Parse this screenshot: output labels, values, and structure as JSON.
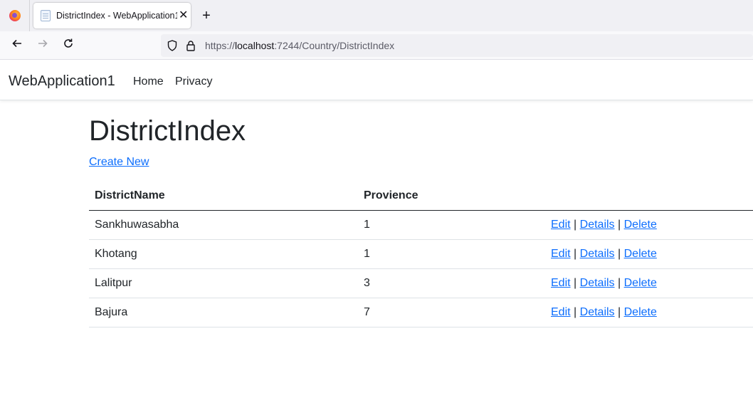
{
  "browser": {
    "tab_title": "DistrictIndex - WebApplication1",
    "tab_close": "✕",
    "new_tab": "+",
    "url_prefix": "https://",
    "url_host": "localhost",
    "url_path": ":7244/Country/DistrictIndex"
  },
  "app": {
    "brand": "WebApplication1",
    "nav": {
      "home": "Home",
      "privacy": "Privacy"
    }
  },
  "page": {
    "title": "DistrictIndex",
    "create_link": "Create New"
  },
  "table": {
    "headers": {
      "name": "DistrictName",
      "provience": "Provience"
    },
    "action_labels": {
      "edit": "Edit",
      "details": "Details",
      "delete": "Delete",
      "sep": "|"
    },
    "rows": [
      {
        "name": "Sankhuwasabha",
        "provience": "1"
      },
      {
        "name": "Khotang",
        "provience": "1"
      },
      {
        "name": "Lalitpur",
        "provience": "3"
      },
      {
        "name": "Bajura",
        "provience": "7"
      }
    ]
  },
  "colors": {
    "link": "#0d6efd",
    "text": "#212529"
  }
}
